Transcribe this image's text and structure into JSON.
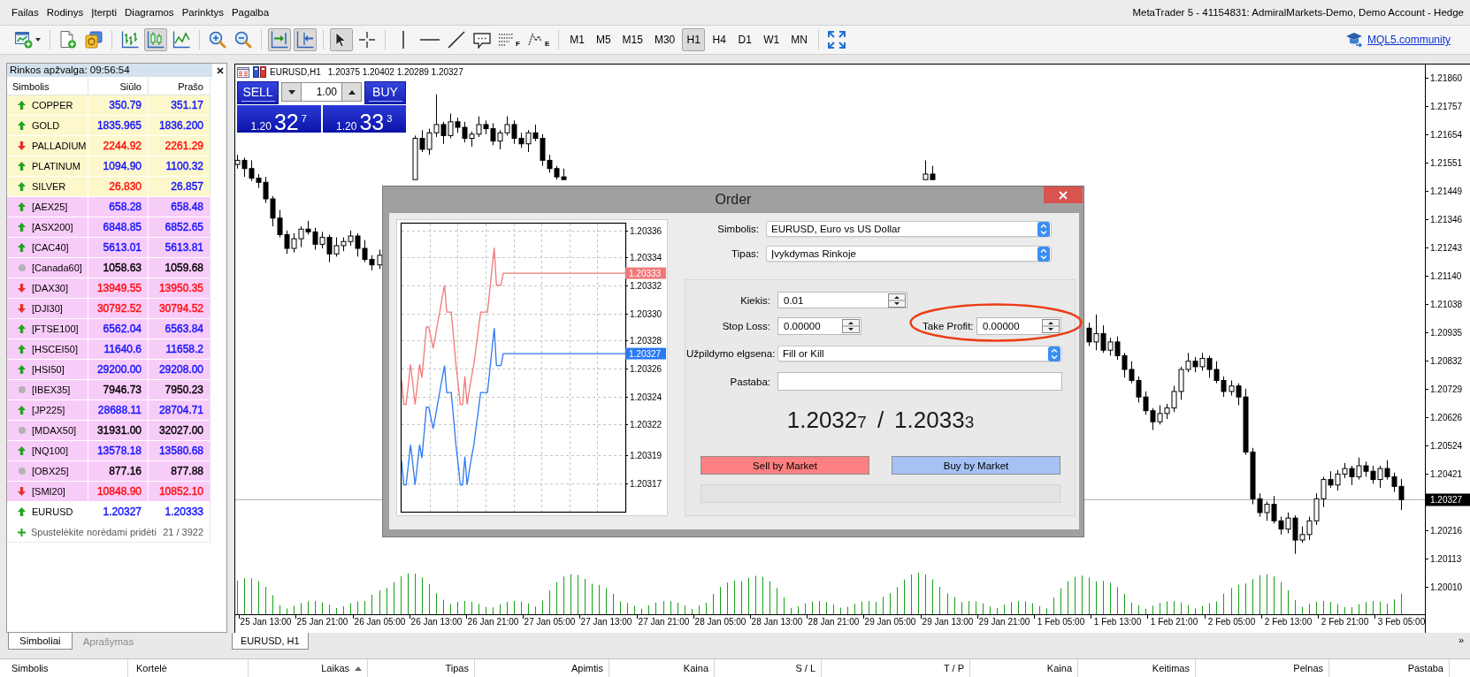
{
  "window": {
    "title": "MetaTrader 5 - 41154831: AdmiralMarkets-Demo, Demo Account - Hedge"
  },
  "menu": [
    "Failas",
    "Rodinys",
    "Įterpti",
    "Diagramos",
    "Parinktys",
    "Pagalba"
  ],
  "toolbar": {
    "chart_types": [
      {
        "selected": false
      },
      {
        "selected": true
      },
      {
        "selected": false
      }
    ],
    "scroll_options": [
      {
        "on": true
      },
      {
        "on": true
      }
    ],
    "pointer_tools": [
      {
        "selected": true
      },
      {
        "selected": false
      }
    ],
    "drawing_tools": [
      {
        "letter": "F"
      },
      {
        "letter": "E"
      }
    ],
    "timeframes": [
      {
        "label": "M1",
        "selected": false
      },
      {
        "label": "M5",
        "selected": false
      },
      {
        "label": "M15",
        "selected": false
      },
      {
        "label": "M30",
        "selected": false
      },
      {
        "label": "H1",
        "selected": true
      },
      {
        "label": "H4",
        "selected": false
      },
      {
        "label": "D1",
        "selected": false
      },
      {
        "label": "W1",
        "selected": false
      },
      {
        "label": "MN",
        "selected": false
      }
    ],
    "community_link": "MQL5.community"
  },
  "market_watch": {
    "title": "Rinkos apžvalga: 09:56:54",
    "columns": [
      "Simbolis",
      "Siūlo",
      "Prašo"
    ],
    "rows": [
      {
        "symbol": "COPPER",
        "kind": "up",
        "color": "#fcf8cc",
        "bid": {
          "value": "350.79",
          "color": "#1212ff"
        },
        "ask": {
          "value": "351.17",
          "color": "#1212ff"
        }
      },
      {
        "symbol": "GOLD",
        "kind": "up",
        "color": "#fcf8cc",
        "bid": {
          "value": "1835.965",
          "color": "#1212ff"
        },
        "ask": {
          "value": "1836.200",
          "color": "#1212ff"
        }
      },
      {
        "symbol": "PALLADIUM",
        "kind": "down",
        "color": "#fcf8cc",
        "bid": {
          "value": "2244.92",
          "color": "#ff0c0c"
        },
        "ask": {
          "value": "2261.29",
          "color": "#ff0c0c"
        }
      },
      {
        "symbol": "PLATINUM",
        "kind": "up",
        "color": "#fcf8cc",
        "bid": {
          "value": "1094.90",
          "color": "#1212ff"
        },
        "ask": {
          "value": "1100.32",
          "color": "#1212ff"
        }
      },
      {
        "symbol": "SILVER",
        "kind": "up",
        "color": "#fcf8cc",
        "bid": {
          "value": "26.830",
          "color": "#ff0c0c"
        },
        "ask": {
          "value": "26.857",
          "color": "#1212ff"
        }
      },
      {
        "symbol": "[AEX25]",
        "kind": "up",
        "color": "#f8ccf8",
        "bid": {
          "value": "658.28",
          "color": "#1212ff"
        },
        "ask": {
          "value": "658.48",
          "color": "#1212ff"
        }
      },
      {
        "symbol": "[ASX200]",
        "kind": "up",
        "color": "#f8ccf8",
        "bid": {
          "value": "6848.85",
          "color": "#1212ff"
        },
        "ask": {
          "value": "6852.65",
          "color": "#1212ff"
        }
      },
      {
        "symbol": "[CAC40]",
        "kind": "up",
        "color": "#f8ccf8",
        "bid": {
          "value": "5613.01",
          "color": "#1212ff"
        },
        "ask": {
          "value": "5613.81",
          "color": "#1212ff"
        }
      },
      {
        "symbol": "[Canada60]",
        "kind": "flat",
        "color": "#f8ccf8",
        "bid": {
          "value": "1058.63",
          "color": "#000000"
        },
        "ask": {
          "value": "1059.68",
          "color": "#000000"
        }
      },
      {
        "symbol": "[DAX30]",
        "kind": "down",
        "color": "#f8ccf8",
        "bid": {
          "value": "13949.55",
          "color": "#ff0c0c"
        },
        "ask": {
          "value": "13950.35",
          "color": "#ff0c0c"
        }
      },
      {
        "symbol": "[DJI30]",
        "kind": "down",
        "color": "#f8ccf8",
        "bid": {
          "value": "30792.52",
          "color": "#ff0c0c"
        },
        "ask": {
          "value": "30794.52",
          "color": "#ff0c0c"
        }
      },
      {
        "symbol": "[FTSE100]",
        "kind": "up",
        "color": "#f8ccf8",
        "bid": {
          "value": "6562.04",
          "color": "#1212ff"
        },
        "ask": {
          "value": "6563.84",
          "color": "#1212ff"
        }
      },
      {
        "symbol": "[HSCEI50]",
        "kind": "up",
        "color": "#f8ccf8",
        "bid": {
          "value": "11640.6",
          "color": "#1212ff"
        },
        "ask": {
          "value": "11658.2",
          "color": "#1212ff"
        }
      },
      {
        "symbol": "[HSI50]",
        "kind": "up",
        "color": "#f8ccf8",
        "bid": {
          "value": "29200.00",
          "color": "#1212ff"
        },
        "ask": {
          "value": "29208.00",
          "color": "#1212ff"
        }
      },
      {
        "symbol": "[IBEX35]",
        "kind": "flat",
        "color": "#f8ccf8",
        "bid": {
          "value": "7946.73",
          "color": "#000000"
        },
        "ask": {
          "value": "7950.23",
          "color": "#000000"
        }
      },
      {
        "symbol": "[JP225]",
        "kind": "up",
        "color": "#f8ccf8",
        "bid": {
          "value": "28688.11",
          "color": "#1212ff"
        },
        "ask": {
          "value": "28704.71",
          "color": "#1212ff"
        }
      },
      {
        "symbol": "[MDAX50]",
        "kind": "flat",
        "color": "#f8ccf8",
        "bid": {
          "value": "31931.00",
          "color": "#000000"
        },
        "ask": {
          "value": "32027.00",
          "color": "#000000"
        }
      },
      {
        "symbol": "[NQ100]",
        "kind": "up",
        "color": "#f8ccf8",
        "bid": {
          "value": "13578.18",
          "color": "#1212ff"
        },
        "ask": {
          "value": "13580.68",
          "color": "#1212ff"
        }
      },
      {
        "symbol": "[OBX25]",
        "kind": "flat",
        "color": "#f8ccf8",
        "bid": {
          "value": "877.16",
          "color": "#000000"
        },
        "ask": {
          "value": "877.88",
          "color": "#000000"
        }
      },
      {
        "symbol": "[SMI20]",
        "kind": "down",
        "color": "#f8ccf8",
        "bid": {
          "value": "10848.90",
          "color": "#ff0c0c"
        },
        "ask": {
          "value": "10852.10",
          "color": "#ff0c0c"
        }
      },
      {
        "symbol": "EURUSD",
        "kind": "up",
        "color": "#ffffff",
        "bid": {
          "value": "1.20327",
          "color": "#1212ff"
        },
        "ask": {
          "value": "1.20333",
          "color": "#1212ff"
        }
      }
    ],
    "add_hint": "Spustelėkite norėdami pridėti",
    "count": "21 / 3922",
    "tabs": [
      {
        "label": "Simboliai",
        "selected": true
      },
      {
        "label": "Aprašymas",
        "selected": false
      }
    ]
  },
  "chart": {
    "symbol": "EURUSD,H1",
    "values": "1.20375 1.20402 1.20289 1.20327",
    "one_click": {
      "sell": "SELL",
      "buy": "BUY",
      "volume": "1.00",
      "sell_price": {
        "prefix": "1.20",
        "big": "32",
        "pip": "7"
      },
      "buy_price": {
        "prefix": "1.20",
        "big": "33",
        "pip": "3"
      }
    },
    "chart_data": {
      "type": "candlestick",
      "categories": [
        null,
        null,
        null,
        null,
        "25 Jan 13:00",
        null,
        null,
        null,
        null,
        null,
        null,
        null,
        "25 Jan 21:00",
        null,
        null,
        null,
        null,
        null,
        null,
        null,
        "26 Jan 05:00",
        null,
        null,
        null,
        null,
        null,
        null,
        null,
        "26 Jan 13:00",
        null,
        null,
        null,
        null,
        null,
        null,
        null,
        "26 Jan 21:00",
        null,
        null,
        null,
        null,
        null,
        null,
        null,
        "27 Jan 05:00",
        null,
        null,
        null,
        null,
        null,
        null,
        null,
        "27 Jan 13:00",
        null,
        null,
        null,
        null,
        null,
        null,
        null,
        "27 Jan 21:00",
        null,
        null,
        null,
        null,
        null,
        null,
        null,
        "28 Jan 05:00",
        null,
        null,
        null,
        null,
        null,
        null,
        null,
        "28 Jan 13:00",
        null,
        null,
        null,
        null,
        null,
        null,
        null,
        "28 Jan 21:00",
        null,
        null,
        null,
        null,
        null,
        null,
        null,
        "29 Jan 05:00",
        null,
        null,
        null,
        null,
        null,
        null,
        null,
        "29 Jan 13:00",
        null,
        null,
        null,
        null,
        null,
        null,
        null,
        "29 Jan 21:00",
        null,
        null,
        null,
        null,
        null,
        null,
        null,
        "1 Feb 05:00",
        null,
        null,
        null,
        null,
        null,
        null,
        null,
        "1 Feb 13:00",
        null,
        null,
        null,
        null,
        null,
        null,
        null,
        "1 Feb 21:00",
        null,
        null,
        null,
        null,
        null,
        null,
        null,
        "2 Feb 05:00",
        null,
        null,
        null,
        null,
        null,
        null,
        null,
        "2 Feb 13:00",
        null,
        null,
        null,
        null,
        null,
        null,
        null,
        "2 Feb 21:00",
        null,
        null,
        null,
        null,
        null,
        null,
        null,
        "3 Feb 05:00"
      ],
      "ohlc": [
        [
          1.21545,
          1.2158,
          1.2153,
          1.2156
        ],
        [
          1.2156,
          1.2157,
          1.215,
          1.2153
        ],
        [
          1.2153,
          1.2156,
          1.21485,
          1.21495
        ],
        [
          1.21495,
          1.2151,
          1.2146,
          1.2148
        ],
        [
          1.2148,
          1.215,
          1.21405,
          1.2142
        ],
        [
          1.2142,
          1.2143,
          1.2132,
          1.2135
        ],
        [
          1.2135,
          1.2138,
          1.2128,
          1.2129
        ],
        [
          1.2129,
          1.21305,
          1.2122,
          1.2124
        ],
        [
          1.2124,
          1.21295,
          1.21225,
          1.21275
        ],
        [
          1.21275,
          1.2132,
          1.21245,
          1.2131
        ],
        [
          1.2131,
          1.2134,
          1.2129,
          1.213
        ],
        [
          1.213,
          1.21315,
          1.21235,
          1.21255
        ],
        [
          1.21255,
          1.213,
          1.2124,
          1.2128
        ],
        [
          1.2128,
          1.2129,
          1.2119,
          1.2122
        ],
        [
          1.2122,
          1.2128,
          1.2121,
          1.2125
        ],
        [
          1.2125,
          1.2128,
          1.2123,
          1.21265
        ],
        [
          1.21265,
          1.21305,
          1.2125,
          1.21285
        ],
        [
          1.21285,
          1.21295,
          1.2121,
          1.2124
        ],
        [
          1.2124,
          1.2127,
          1.2119,
          1.212
        ],
        [
          1.212,
          1.21215,
          1.2116,
          1.2118
        ],
        [
          1.2118,
          1.21235,
          1.21165,
          1.21215
        ],
        null,
        null,
        null,
        null,
        [
          1.2149,
          1.2165,
          1.2149,
          1.2164
        ],
        [
          1.2164,
          1.2167,
          1.2159,
          1.216
        ],
        [
          1.216,
          1.21675,
          1.2158,
          1.2166
        ],
        [
          1.2166,
          1.218,
          1.21645,
          1.2169
        ],
        [
          1.2169,
          1.217,
          1.2162,
          1.2165
        ],
        [
          1.2165,
          1.2173,
          1.2164,
          1.217
        ],
        [
          1.217,
          1.21715,
          1.2166,
          1.2168
        ],
        [
          1.2168,
          1.217,
          1.21625,
          1.2164
        ],
        [
          1.2164,
          1.21665,
          1.2161,
          1.21655
        ],
        [
          1.21655,
          1.2172,
          1.21645,
          1.2169
        ],
        [
          1.2169,
          1.21705,
          1.21655,
          1.21675
        ],
        [
          1.21675,
          1.21695,
          1.21615,
          1.2163
        ],
        [
          1.2163,
          1.2167,
          1.216,
          1.2166
        ],
        [
          1.2166,
          1.2172,
          1.2165,
          1.2169
        ],
        [
          1.2169,
          1.21705,
          1.2162,
          1.2164
        ],
        [
          1.2164,
          1.2166,
          1.21605,
          1.2162
        ],
        [
          1.2162,
          1.2167,
          1.2159,
          1.2166
        ],
        [
          1.2166,
          1.2169,
          1.2163,
          1.2164
        ],
        [
          1.2164,
          1.21655,
          1.2154,
          1.2156
        ],
        [
          1.2156,
          1.2158,
          1.21515,
          1.2153
        ],
        [
          1.2153,
          1.2154,
          1.2149,
          1.215
        ],
        [
          1.215,
          1.2153,
          1.2149,
          1.2149
        ],
        null,
        null,
        null,
        null,
        null,
        null,
        null,
        null,
        null,
        null,
        null,
        null,
        null,
        null,
        null,
        null,
        null,
        null,
        null,
        null,
        null,
        null,
        null,
        null,
        null,
        null,
        null,
        null,
        null,
        null,
        null,
        null,
        null,
        null,
        null,
        null,
        null,
        null,
        null,
        null,
        null,
        null,
        null,
        null,
        null,
        null,
        null,
        null,
        null,
        null,
        [
          1.2149,
          1.2156,
          1.2149,
          1.2151
        ],
        [
          1.2151,
          1.2154,
          1.2149,
          1.2149
        ],
        null,
        null,
        null,
        null,
        null,
        null,
        null,
        null,
        null,
        null,
        null,
        null,
        null,
        null,
        null,
        null,
        null,
        null,
        null,
        null,
        null,
        [
          1.2095,
          1.2097,
          1.20885,
          1.209
        ],
        [
          1.209,
          1.21,
          1.2087,
          1.2093
        ],
        [
          1.2093,
          1.2096,
          1.2086,
          1.2087
        ],
        [
          1.2087,
          1.20915,
          1.2085,
          1.209
        ],
        [
          1.209,
          1.2092,
          1.20835,
          1.2085
        ],
        [
          1.2085,
          1.2086,
          1.2077,
          1.208
        ],
        [
          1.208,
          1.2083,
          1.2075,
          1.2076
        ],
        [
          1.2076,
          1.20775,
          1.2068,
          1.207
        ],
        [
          1.207,
          1.2072,
          1.20635,
          1.2065
        ],
        [
          1.2065,
          1.2066,
          1.2058,
          1.2061
        ],
        [
          1.2061,
          1.2067,
          1.206,
          1.2064
        ],
        [
          1.2064,
          1.20675,
          1.2062,
          1.2066
        ],
        [
          1.2066,
          1.2074,
          1.20645,
          1.2072
        ],
        [
          1.2072,
          1.2081,
          1.2069,
          1.208
        ],
        [
          1.208,
          1.2086,
          1.2079,
          1.2083
        ],
        [
          1.2083,
          1.20845,
          1.2079,
          1.2081
        ],
        [
          1.2081,
          1.2086,
          1.20795,
          1.2084
        ],
        [
          1.2084,
          1.2085,
          1.2077,
          1.208
        ],
        [
          1.208,
          1.2083,
          1.2075,
          1.2076
        ],
        [
          1.2076,
          1.20775,
          1.207,
          1.2072
        ],
        [
          1.2072,
          1.2076,
          1.20705,
          1.2074
        ],
        [
          1.2074,
          1.2075,
          1.2067,
          1.207
        ],
        [
          1.207,
          1.2073,
          1.2049,
          1.205
        ],
        [
          1.205,
          1.20515,
          1.2031,
          1.2033
        ],
        [
          1.2033,
          1.2035,
          1.20265,
          1.2028
        ],
        [
          1.2028,
          1.2032,
          1.2025,
          1.2031
        ],
        [
          1.2031,
          1.2034,
          1.2024,
          1.2025
        ],
        [
          1.2025,
          1.20265,
          1.202,
          1.2022
        ],
        [
          1.2022,
          1.2028,
          1.20205,
          1.2026
        ],
        [
          1.2026,
          1.2027,
          1.2013,
          1.2018
        ],
        [
          1.2018,
          1.2023,
          1.2017,
          1.202
        ],
        [
          1.202,
          1.20265,
          1.2018,
          1.2025
        ],
        [
          1.2025,
          1.2035,
          1.20235,
          1.2033
        ],
        [
          1.2033,
          1.2041,
          1.203,
          1.204
        ],
        [
          1.204,
          1.2043,
          1.2037,
          1.2038
        ],
        [
          1.2038,
          1.20435,
          1.2036,
          1.2042
        ],
        [
          1.2042,
          1.2046,
          1.20405,
          1.2044
        ],
        [
          1.2044,
          1.2045,
          1.2038,
          1.2041
        ],
        [
          1.2041,
          1.2048,
          1.204,
          1.2045
        ],
        [
          1.2045,
          1.20465,
          1.2041,
          1.2043
        ],
        [
          1.2043,
          1.2045,
          1.20385,
          1.204
        ],
        [
          1.204,
          1.2045,
          1.2037,
          1.2044
        ],
        [
          1.2044,
          1.2047,
          1.204,
          1.2041
        ],
        [
          1.2041,
          1.20425,
          1.20355,
          1.20375
        ],
        [
          1.20375,
          1.20402,
          1.20289,
          1.20327
        ]
      ],
      "ylim": [
        1.199104,
        1.219082
      ],
      "yticks": [
        {
          "value": 1.2186,
          "label": "1.21860"
        },
        {
          "value": 1.21757,
          "label": "1.21757"
        },
        {
          "value": 1.21654,
          "label": "1.21654"
        },
        {
          "value": 1.21551,
          "label": "1.21551"
        },
        {
          "value": 1.21449,
          "label": "1.21449"
        },
        {
          "value": 1.21346,
          "label": "1.21346"
        },
        {
          "value": 1.21243,
          "label": "1.21243"
        },
        {
          "value": 1.2114,
          "label": "1.21140"
        },
        {
          "value": 1.21038,
          "label": "1.21038"
        },
        {
          "value": 1.20935,
          "label": "1.20935"
        },
        {
          "value": 1.20832,
          "label": "1.20832"
        },
        {
          "value": 1.20729,
          "label": "1.20729"
        },
        {
          "value": 1.20626,
          "label": "1.20626"
        },
        {
          "value": 1.20524,
          "label": "1.20524"
        },
        {
          "value": 1.20421,
          "label": "1.20421"
        },
        {
          "value": 1.20216,
          "label": "1.20216"
        },
        {
          "value": 1.20113,
          "label": "1.20113"
        },
        {
          "value": 1.2001,
          "label": "1.20010"
        }
      ]
    },
    "current_price": "1.20327",
    "tabs": [
      {
        "label": "EURUSD, H1",
        "selected": true
      }
    ],
    "tab_overflow": "»"
  },
  "order_dialog": {
    "title": "Order",
    "tick_chart": {
      "chart_data": {
        "type": "line",
        "grid": true,
        "categories": [
          null,
          null,
          null,
          null,
          null,
          null,
          null,
          null,
          null,
          null,
          null,
          null,
          null,
          null,
          null,
          null,
          null,
          null,
          null,
          null,
          null,
          null,
          null,
          null,
          null,
          null,
          null,
          null,
          null,
          null,
          null,
          null,
          null,
          null,
          null,
          null,
          null,
          null,
          null,
          null,
          null,
          null,
          null,
          null,
          null,
          null,
          null,
          null,
          null,
          null,
          null,
          null,
          null,
          null,
          null,
          null,
          null,
          null,
          null,
          null,
          null,
          null,
          null,
          null,
          null,
          null,
          null,
          null,
          null,
          null,
          null,
          null,
          null,
          null,
          null,
          null,
          null,
          null,
          null,
          null,
          null,
          null,
          null,
          null,
          null,
          null,
          null,
          null,
          null,
          null,
          null,
          null,
          null,
          null,
          null,
          null,
          null,
          null,
          null,
          null
        ],
        "series": [
          {
            "color": "#f07878",
            "values": [
              1.20325,
              1.203232,
              1.203232,
              1.203247,
              1.203262,
              1.203247,
              1.203232,
              1.203247,
              1.203262,
              1.203252,
              1.203271,
              1.20329,
              1.20329,
              1.203282,
              1.203274,
              1.203283,
              1.203293,
              1.203302,
              1.203312,
              1.203321,
              1.203301,
              1.203301,
              1.203301,
              1.203282,
              1.203263,
              1.203248,
              1.203232,
              1.203232,
              1.203253,
              1.203232,
              1.203243,
              1.203253,
              1.203262,
              1.203275,
              1.203288,
              1.203301,
              1.203301,
              1.203301,
              1.203301,
              1.203317,
              1.203333,
              1.203349,
              1.203321,
              1.203321,
              1.203321,
              1.20333,
              1.20333,
              1.20333,
              1.20333,
              1.20333,
              1.20333,
              1.20333,
              1.20333,
              1.20333,
              1.20333,
              1.20333,
              1.20333,
              1.20333,
              1.20333,
              1.20333,
              1.20333,
              1.20333,
              1.20333,
              1.20333,
              1.20333,
              1.20333,
              1.20333,
              1.20333,
              1.20333,
              1.20333,
              1.20333,
              1.20333,
              1.20333,
              1.20333,
              1.20333,
              1.20333,
              1.20333,
              1.20333,
              1.20333,
              1.20333,
              1.20333,
              1.20333,
              1.20333,
              1.20333,
              1.20333,
              1.20333,
              1.20333,
              1.20333,
              1.20333,
              1.20333,
              1.20333,
              1.20333,
              1.20333,
              1.20333,
              1.20333,
              1.20333,
              1.20333,
              1.20333,
              1.20333,
              1.20333
            ]
          },
          {
            "color": "#2a78f2",
            "values": [
              1.20319,
              1.203172,
              1.203172,
              1.203187,
              1.203202,
              1.203187,
              1.203172,
              1.203187,
              1.203202,
              1.203192,
              1.203211,
              1.20323,
              1.20323,
              1.203222,
              1.203214,
              1.203223,
              1.203233,
              1.203242,
              1.203252,
              1.203261,
              1.203241,
              1.203241,
              1.203241,
              1.203222,
              1.203203,
              1.203188,
              1.203172,
              1.203172,
              1.203193,
              1.203172,
              1.203183,
              1.203193,
              1.203202,
              1.203215,
              1.203228,
              1.203241,
              1.203241,
              1.203241,
              1.203241,
              1.203257,
              1.203273,
              1.203289,
              1.203261,
              1.203261,
              1.203261,
              1.20327,
              1.20327,
              1.20327,
              1.20327,
              1.20327,
              1.20327,
              1.20327,
              1.20327,
              1.20327,
              1.20327,
              1.20327,
              1.20327,
              1.20327,
              1.20327,
              1.20327,
              1.20327,
              1.20327,
              1.20327,
              1.20327,
              1.20327,
              1.20327,
              1.20327,
              1.20327,
              1.20327,
              1.20327,
              1.20327,
              1.20327,
              1.20327,
              1.20327,
              1.20327,
              1.20327,
              1.20327,
              1.20327,
              1.20327,
              1.20327,
              1.20327,
              1.20327,
              1.20327,
              1.20327,
              1.20327,
              1.20327,
              1.20327,
              1.20327,
              1.20327,
              1.20327,
              1.20327,
              1.20327,
              1.20327,
              1.20327,
              1.20327,
              1.20327,
              1.20327,
              1.20327,
              1.20327,
              1.20327
            ]
          }
        ],
        "ylim": [
          1.203152,
          1.203367
        ],
        "yticks": [
          {
            "value": 1.203362,
            "label": "1.20336"
          },
          {
            "value": 1.203342,
            "label": "1.20334"
          },
          {
            "value": 1.203321,
            "label": "1.20332"
          },
          {
            "value": 1.2033,
            "label": "1.20330"
          },
          {
            "value": 1.20328,
            "label": "1.20328"
          },
          {
            "value": 1.203259,
            "label": "1.20326"
          },
          {
            "value": 1.203238,
            "label": "1.20324"
          },
          {
            "value": 1.203217,
            "label": "1.20322"
          },
          {
            "value": 1.203194,
            "label": "1.20319"
          },
          {
            "value": 1.203173,
            "label": "1.20317"
          }
        ]
      },
      "price_tags": [
        "1.20333",
        "1.20327"
      ]
    },
    "symbol": {
      "label": "Simbolis:",
      "value": "EURUSD, Euro vs US Dollar"
    },
    "type": {
      "label": "Tipas:",
      "value": "Įvykdymas Rinkoje"
    },
    "volume": {
      "label": "Kiekis:",
      "value": "0.01"
    },
    "stop_loss": {
      "label": "Stop Loss:",
      "value": "0.00000"
    },
    "take_profit": {
      "label": "Take Profit:",
      "value": "0.00000",
      "highlighted": true
    },
    "fill_policy": {
      "label": "Užpildymo elgsena:",
      "value": "Fill or Kill"
    },
    "comment": {
      "label": "Pastaba:"
    },
    "quote": {
      "bid": {
        "main": "1.2032",
        "pip": "7"
      },
      "separator": "/",
      "ask": {
        "main": "1.2033",
        "pip": "3"
      }
    },
    "buttons": [
      {
        "kind": "sell",
        "label": "Sell by Market"
      },
      {
        "kind": "buy",
        "label": "Buy by Market"
      }
    ]
  },
  "terminal": {
    "columns": [
      {
        "label": "Simbolis",
        "sorted": false
      },
      {
        "label": "Kortelė",
        "sorted": false
      },
      {
        "label": "Laikas",
        "sorted": true
      },
      {
        "label": "Tipas",
        "sorted": false
      },
      {
        "label": "Apimtis",
        "sorted": false
      },
      {
        "label": "Kaina",
        "sorted": false
      },
      {
        "label": "S / L",
        "sorted": false
      },
      {
        "label": "T / P",
        "sorted": false
      },
      {
        "label": "Kaina",
        "sorted": false
      },
      {
        "label": "Keitimas",
        "sorted": false
      },
      {
        "label": "Pelnas",
        "sorted": false
      },
      {
        "label": "Pastaba",
        "sorted": false
      }
    ]
  }
}
